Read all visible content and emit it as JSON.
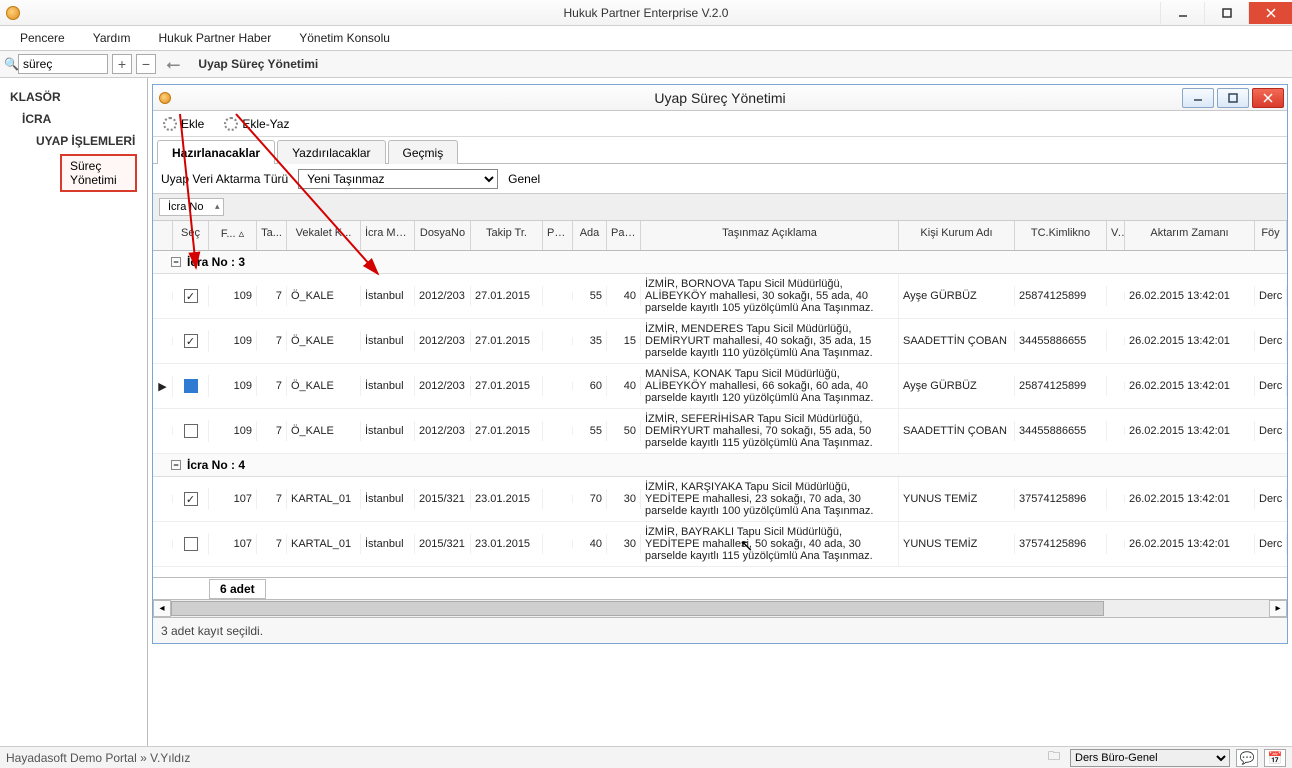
{
  "app": {
    "title": "Hukuk Partner Enterprise V.2.0"
  },
  "menu": {
    "pencere": "Pencere",
    "yardim": "Yardım",
    "haber": "Hukuk Partner Haber",
    "konsol": "Yönetim Konsolu"
  },
  "toolbar": {
    "search_value": "süreç",
    "crumb": "Uyap Süreç Yönetimi"
  },
  "sidebar": {
    "klasor": "KLASÖR",
    "icra": "İCRA",
    "uyap": "UYAP İŞLEMLERİ",
    "leaf": "Süreç Yönetimi"
  },
  "inner": {
    "title": "Uyap Süreç Yönetimi",
    "btn_ekle": "Ekle",
    "btn_ekleyaz": "Ekle-Yaz",
    "tabs": {
      "t1": "Hazırlanacaklar",
      "t2": "Yazdırılacaklar",
      "t3": "Geçmiş"
    },
    "filter_label": "Uyap Veri Aktarma Türü",
    "filter_value": "Yeni Taşınmaz",
    "filter_genel": "Genel",
    "group_chip": "İcra No",
    "headers": {
      "sec": "Seç",
      "f": "F...  ▵",
      "ta": "Ta...",
      "vek": "Vekalet K...",
      "mud": "İcra Mü...",
      "dno": "DosyaNo",
      "ttr": "Takip Tr.",
      "pa": "Pa...",
      "ada": "Ada",
      "par": "Par...",
      "acik": "Taşınmaz Açıklama",
      "kisi": "Kişi Kurum Adı",
      "tc": "TC.Kimlikno",
      "v": "V...",
      "akt": "Aktarım Zamanı",
      "foy": "Föy"
    },
    "group1": "İcra No : 3",
    "group2": "İcra No : 4",
    "rows": [
      {
        "chk": true,
        "ind": "",
        "f": "109",
        "ta": "7",
        "vek": "Ö_KALE",
        "mud": "İstanbul",
        "dno": "2012/203",
        "ttr": "27.01.2015",
        "pa": "",
        "ada": "55",
        "par": "40",
        "acik": "İZMİR, BORNOVA Tapu Sicil Müdürlüğü, ALİBEYKÖY mahallesi, 30 sokağı, 55 ada, 40 parselde kayıtlı 105 yüzölçümlü Ana Taşınmaz.",
        "kisi": "Ayşe GÜRBÜZ",
        "tc": "25874125899",
        "akt": "26.02.2015 13:42:01",
        "foy": "Derc"
      },
      {
        "chk": true,
        "ind": "",
        "f": "109",
        "ta": "7",
        "vek": "Ö_KALE",
        "mud": "İstanbul",
        "dno": "2012/203",
        "ttr": "27.01.2015",
        "pa": "",
        "ada": "35",
        "par": "15",
        "acik": "İZMİR, MENDERES Tapu Sicil Müdürlüğü, DEMİRYURT mahallesi, 40 sokağı, 35 ada, 15 parselde kayıtlı 110 yüzölçümlü Ana Taşınmaz.",
        "kisi": "SAADETTİN ÇOBAN",
        "tc": "34455886655",
        "akt": "26.02.2015 13:42:01",
        "foy": "Derc"
      },
      {
        "chk": false,
        "ind": "▶",
        "sel": true,
        "f": "109",
        "ta": "7",
        "vek": "Ö_KALE",
        "mud": "İstanbul",
        "dno": "2012/203",
        "ttr": "27.01.2015",
        "pa": "",
        "ada": "60",
        "par": "40",
        "acik": "MANİSA, KONAK Tapu Sicil Müdürlüğü, ALİBEYKÖY mahallesi, 66 sokağı, 60 ada, 40 parselde kayıtlı 120 yüzölçümlü Ana Taşınmaz.",
        "kisi": "Ayşe GÜRBÜZ",
        "tc": "25874125899",
        "akt": "26.02.2015 13:42:01",
        "foy": "Derc"
      },
      {
        "chk": false,
        "ind": "",
        "f": "109",
        "ta": "7",
        "vek": "Ö_KALE",
        "mud": "İstanbul",
        "dno": "2012/203",
        "ttr": "27.01.2015",
        "pa": "",
        "ada": "55",
        "par": "50",
        "acik": "İZMİR, SEFERİHİSAR Tapu Sicil Müdürlüğü, DEMİRYURT mahallesi, 70 sokağı, 55 ada, 50 parselde kayıtlı 115 yüzölçümlü Ana Taşınmaz.",
        "kisi": "SAADETTİN ÇOBAN",
        "tc": "34455886655",
        "akt": "26.02.2015 13:42:01",
        "foy": "Derc"
      }
    ],
    "rows2": [
      {
        "chk": true,
        "ind": "",
        "f": "107",
        "ta": "7",
        "vek": "KARTAL_01",
        "mud": "İstanbul",
        "dno": "2015/321",
        "ttr": "23.01.2015",
        "pa": "",
        "ada": "70",
        "par": "30",
        "acik": "İZMİR, KARŞIYAKA Tapu Sicil Müdürlüğü, YEDİTEPE mahallesi, 23 sokağı, 70 ada, 30 parselde kayıtlı 100 yüzölçümlü Ana Taşınmaz.",
        "kisi": "YUNUS TEMİZ",
        "tc": "37574125896",
        "akt": "26.02.2015 13:42:01",
        "foy": "Derc"
      },
      {
        "chk": false,
        "ind": "",
        "f": "107",
        "ta": "7",
        "vek": "KARTAL_01",
        "mud": "İstanbul",
        "dno": "2015/321",
        "ttr": "23.01.2015",
        "pa": "",
        "ada": "40",
        "par": "30",
        "acik": "İZMİR, BAYRAKLI Tapu Sicil Müdürlüğü, YEDİTEPE mahallesi, 50 sokağı, 40 ada, 30 parselde kayıtlı 115 yüzölçümlü Ana Taşınmaz.",
        "kisi": "YUNUS TEMİZ",
        "tc": "37574125896",
        "akt": "26.02.2015 13:42:01",
        "foy": "Derc"
      }
    ],
    "count": "6 adet",
    "status": "3 adet kayıt seçildi."
  },
  "status": {
    "left": "Hayadasoft Demo Portal » V.Yıldız",
    "combo": "Ders Büro-Genel"
  }
}
